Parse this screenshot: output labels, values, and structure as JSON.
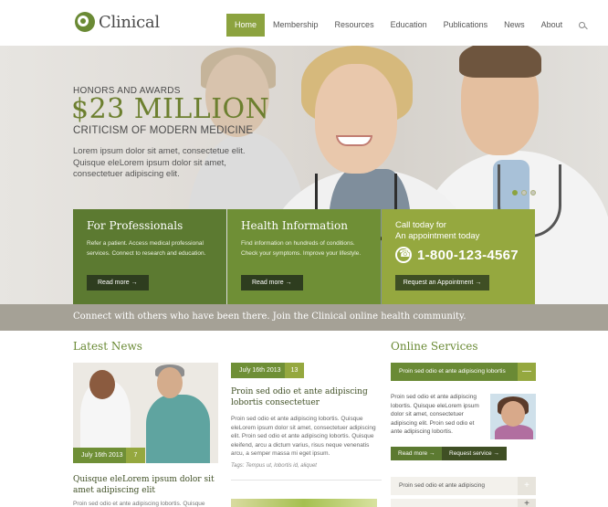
{
  "brand": {
    "name": "Clinical",
    "accent": "#6a8a35",
    "accent_light": "#95a83f"
  },
  "nav": {
    "items": [
      "Home",
      "Membership",
      "Resources",
      "Education",
      "Publications",
      "News",
      "About"
    ],
    "active": "Home",
    "search_icon": "search-icon"
  },
  "hero": {
    "kicker": "HONORS AND AWARDS",
    "headline": "$23 MILLION",
    "subheadline": "CRITICISM OF MODERN MEDICINE",
    "body": "Lorem ipsum dolor sit amet, consectetue elit. Quisque eleLorem ipsum dolor sit amet, consectetuer adipiscing elit.",
    "slides": 3,
    "active_slide": 1
  },
  "features": [
    {
      "title": "For Professionals",
      "text": "Refer a patient. Access medical professional services. Connect to research and education.",
      "button": "Read more"
    },
    {
      "title": "Health Information",
      "text": "Find information on hundreds of conditions. Check your symptoms. Improve your lifestyle.",
      "button": "Read more"
    },
    {
      "title_line1": "Call today for",
      "title_line2": "An appointment today",
      "phone": "1-800-123-4567",
      "button": "Request an Appointment"
    }
  ],
  "banner": {
    "text": "Connect with others who have been there. Join the Clinical online health community."
  },
  "news": {
    "title": "Latest News",
    "articles": [
      {
        "date": "July 16th 2013",
        "count": "7",
        "title": "Quisque eleLorem ipsum dolor sit amet adipiscing elit",
        "snippet": "Proin sed odio et ante adipiscing lobortis. Quisque"
      },
      {
        "date": "July 16th 2013",
        "count": "13",
        "title": "Proin sed odio et ante adipiscing lobortis consectetuer",
        "body": "Proin sed odio et ante adipiscing lobortis. Quisque eleLorem ipsum dolor sit amet, consectetuer adipiscing elit. Proin sed odio et ante adipiscing lobortis. Quisque eleifend, arcu a dictum varius, risus neque venenatis arcu, a semper massa mi eget ipsum.",
        "tags": "Tags: Tempus ut, lobortis id, aliquet"
      }
    ]
  },
  "services": {
    "title": "Online Services",
    "items": [
      {
        "label": "Proin sed odio et ante adipiscing lobortis",
        "toggle": "—",
        "text": "Proin sed odio et ante adipiscing lobortis. Quisque eleLorem ipsum dolor sit amet, consectetuer adipiscing elit. Proin sed odio et ante adipiscing lobortis.",
        "buttons": [
          "Read more",
          "Request service"
        ]
      },
      {
        "label": "Proin sed odio et ante adipiscing",
        "toggle": "+"
      },
      {
        "label": "",
        "toggle": "+"
      }
    ]
  }
}
